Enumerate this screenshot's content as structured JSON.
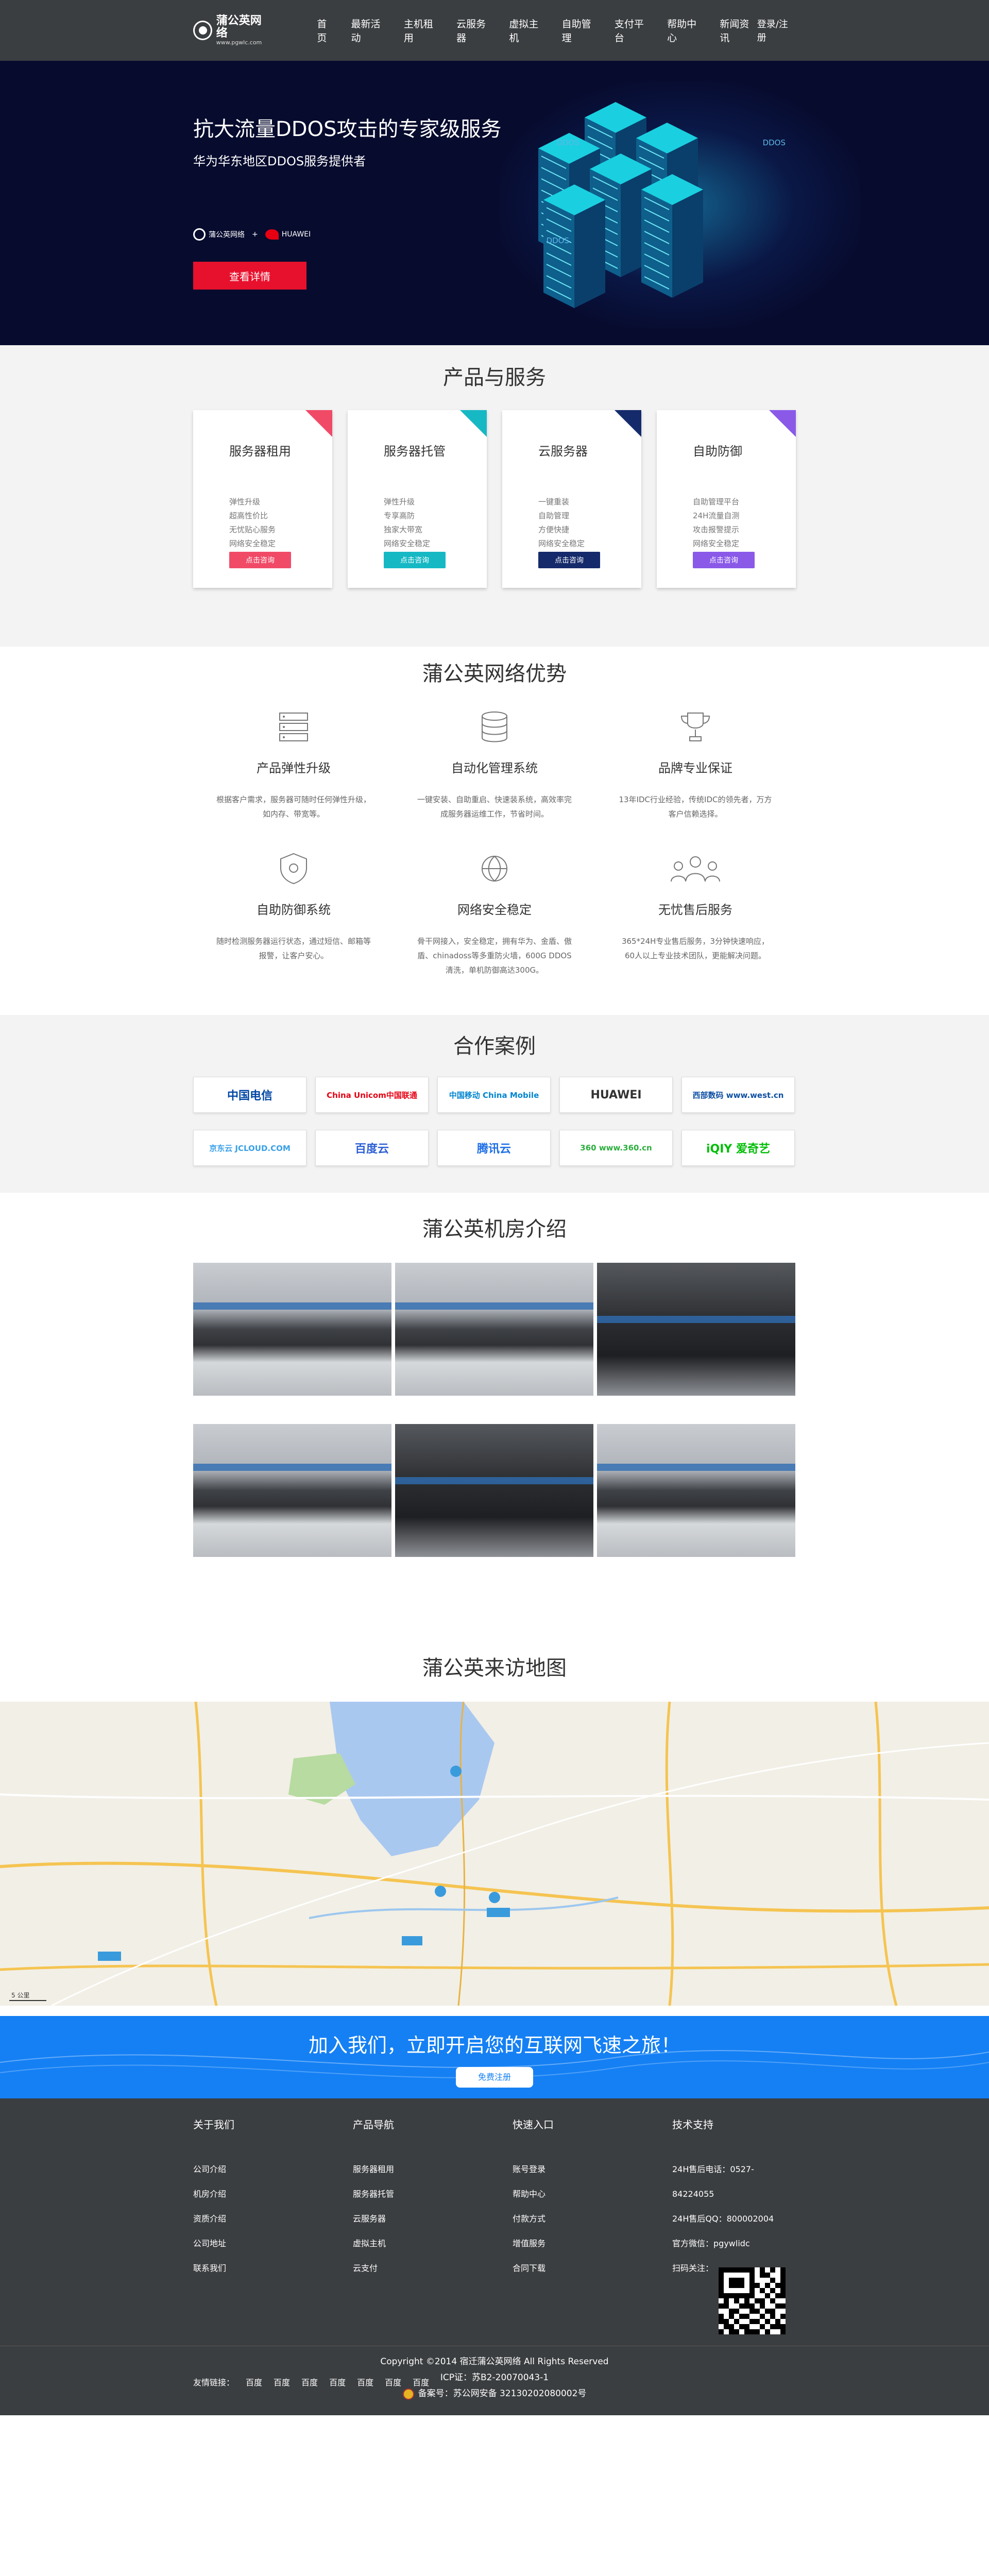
{
  "nav": {
    "logo_name": "蒲公英网络",
    "logo_url": "www.pgwlc.com",
    "items": [
      "首页",
      "最新活动",
      "主机租用",
      "云服务器",
      "虚拟主机",
      "自助管理",
      "支付平台",
      "帮助中心",
      "新闻资讯"
    ],
    "login": "登录/注册"
  },
  "banner": {
    "title": "抗大流量DDOS攻击的专家级服务",
    "subtitle": "华为华东地区DDOS服务提供者",
    "partner_a": "蒲公英网络",
    "partner_b": "HUAWEI",
    "plus": "+",
    "button": "查看详情",
    "tags": [
      "DDOS",
      "DDOS",
      "DDOS"
    ]
  },
  "products": {
    "title": "产品与服务",
    "cards": [
      {
        "name": "服务器租用",
        "features": [
          "弹性升级",
          "超高性价比",
          "无忧贴心服务",
          "网络安全稳定"
        ],
        "button": "点击咨询",
        "color": "#f04a67"
      },
      {
        "name": "服务器托管",
        "features": [
          "弹性升级",
          "专享高防",
          "独家大带宽",
          "网络安全稳定"
        ],
        "button": "点击咨询",
        "color": "#16b8c4"
      },
      {
        "name": "云服务器",
        "features": [
          "一键重装",
          "自助管理",
          "方便快捷",
          "网络安全稳定"
        ],
        "button": "点击咨询",
        "color": "#142a6b"
      },
      {
        "name": "自助防御",
        "features": [
          "自助管理平台",
          "24H流量自测",
          "攻击报警提示",
          "网络安全稳定"
        ],
        "button": "点击咨询",
        "color": "#8a59e8"
      }
    ]
  },
  "advantages": {
    "title": "蒲公英网络优势",
    "items": [
      {
        "name": "产品弹性升级",
        "desc": "根据客户需求，服务器可随时任何弹性升级，如内存、带宽等。",
        "icon": "server-stack-icon"
      },
      {
        "name": "自动化管理系统",
        "desc": "一键安装、自助重启、快速装系统，高效率完成服务器运维工作，节省时间。",
        "icon": "database-icon"
      },
      {
        "name": "品牌专业保证",
        "desc": "13年IDC行业经验，传统IDC的领先者，万方客户信赖选择。",
        "icon": "trophy-icon"
      },
      {
        "name": "自助防御系统",
        "desc": "随时检测服务器运行状态，通过短信、邮箱等报警，让客户安心。",
        "icon": "shield-gear-icon"
      },
      {
        "name": "网络安全稳定",
        "desc": "骨干网接入，安全稳定，拥有华为、金盾、傲盾、chinadoss等多重防火墙，600G DDOS清洗，单机防御高达300G。",
        "icon": "network-globe-icon"
      },
      {
        "name": "无忧售后服务",
        "desc": "365*24H专业售后服务，3分钟快速响应，60人以上专业技术团队，更能解决问题。",
        "icon": "support-team-icon"
      }
    ]
  },
  "cases": {
    "title": "合作案例",
    "logos": [
      {
        "name": "中国电信",
        "color": "#0046a5"
      },
      {
        "name": "China Unicom中国联通",
        "color": "#e60012"
      },
      {
        "name": "中国移动 China Mobile",
        "color": "#0085d0"
      },
      {
        "name": "HUAWEI",
        "color": "#333333"
      },
      {
        "name": "西部数码 www.west.cn",
        "color": "#0d4fa3"
      },
      {
        "name": "京东云 JCLOUD.COM",
        "color": "#39a0e8"
      },
      {
        "name": "百度云",
        "color": "#2d5fd4"
      },
      {
        "name": "腾讯云",
        "color": "#1e6ee6"
      },
      {
        "name": "360 www.360.cn",
        "color": "#2aae3c"
      },
      {
        "name": "iQIY 爱奇艺",
        "color": "#00be06"
      }
    ]
  },
  "idc": {
    "title": "蒲公英机房介绍"
  },
  "map": {
    "title": "蒲公英来访地图",
    "scale": "5 公里"
  },
  "join": {
    "text": "加入我们，立即开启您的互联网飞速之旅！",
    "button": "免费注册"
  },
  "footer": {
    "columns": [
      {
        "title": "关于我们",
        "items": [
          "公司介绍",
          "机房介绍",
          "资质介绍",
          "公司地址",
          "联系我们"
        ]
      },
      {
        "title": "产品导航",
        "items": [
          "服务器租用",
          "服务器托管",
          "云服务器",
          "虚拟主机",
          "云支付"
        ]
      },
      {
        "title": "快速入口",
        "items": [
          "账号登录",
          "帮助中心",
          "付款方式",
          "增值服务",
          "合同下载"
        ]
      },
      {
        "title": "技术支持",
        "items": [
          "24H售后电话：0527-84224055",
          "24H售后QQ：800002004",
          "官方微信：pgywlidc",
          "扫码关注："
        ]
      }
    ],
    "links_label": "友情链接：",
    "links": [
      "百度",
      "百度",
      "百度",
      "百度",
      "百度",
      "百度",
      "百度"
    ],
    "copyright": "Copyright ©2014 宿迁蒲公英网络 All Rights Reserved",
    "icp": "ICP证：苏B2-20070043-1",
    "police": "备案号：苏公网安备 32130202080002号"
  }
}
